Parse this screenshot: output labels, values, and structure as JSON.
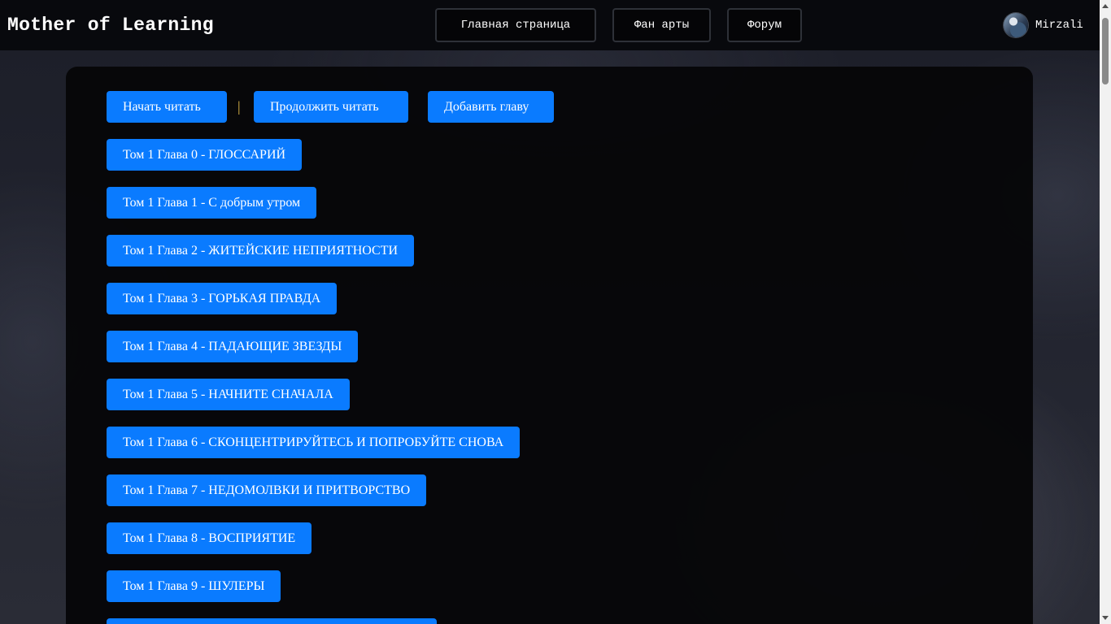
{
  "header": {
    "site_title": "Mother of Learning",
    "nav": {
      "home": "Главная страница",
      "fanart": "Фан арты",
      "forum": "Форум"
    },
    "user": {
      "name": "Mirzali"
    }
  },
  "actions": {
    "start": "Начать читать",
    "separator": "|",
    "continue": "Продолжить читать",
    "add": "Добавить главу"
  },
  "chapters": [
    "Том 1 Глава 0 - ГЛОССАРИЙ",
    "Том 1 Глава 1 - С добрым утром",
    "Том 1 Глава 2 - ЖИТЕЙСКИЕ НЕПРИЯТНОСТИ",
    "Том 1 Глава 3 - ГОРЬКАЯ ПРАВДА",
    "Том 1 Глава 4 - ПАДАЮЩИЕ ЗВЕЗДЫ",
    "Том 1 Глава 5 - НАЧНИТЕ СНАЧАЛА",
    "Том 1 Глава 6 - СКОНЦЕНТРИРУЙТЕСЬ И ПОПРОБУЙТЕ СНОВА",
    "Том 1 Глава 7 - НЕДОМОЛВКИ И ПРИТВОРСТВО",
    "Том 1 Глава 8 - ВОСПРИЯТИЕ",
    "Том 1 Глава 9 - ШУЛЕРЫ"
  ],
  "colors": {
    "accent": "#0a7bff",
    "separator": "#e0b84a",
    "header_bg": "#08090d",
    "panel_bg": "#060608"
  },
  "icons": {
    "avatar": "user-avatar-image"
  }
}
